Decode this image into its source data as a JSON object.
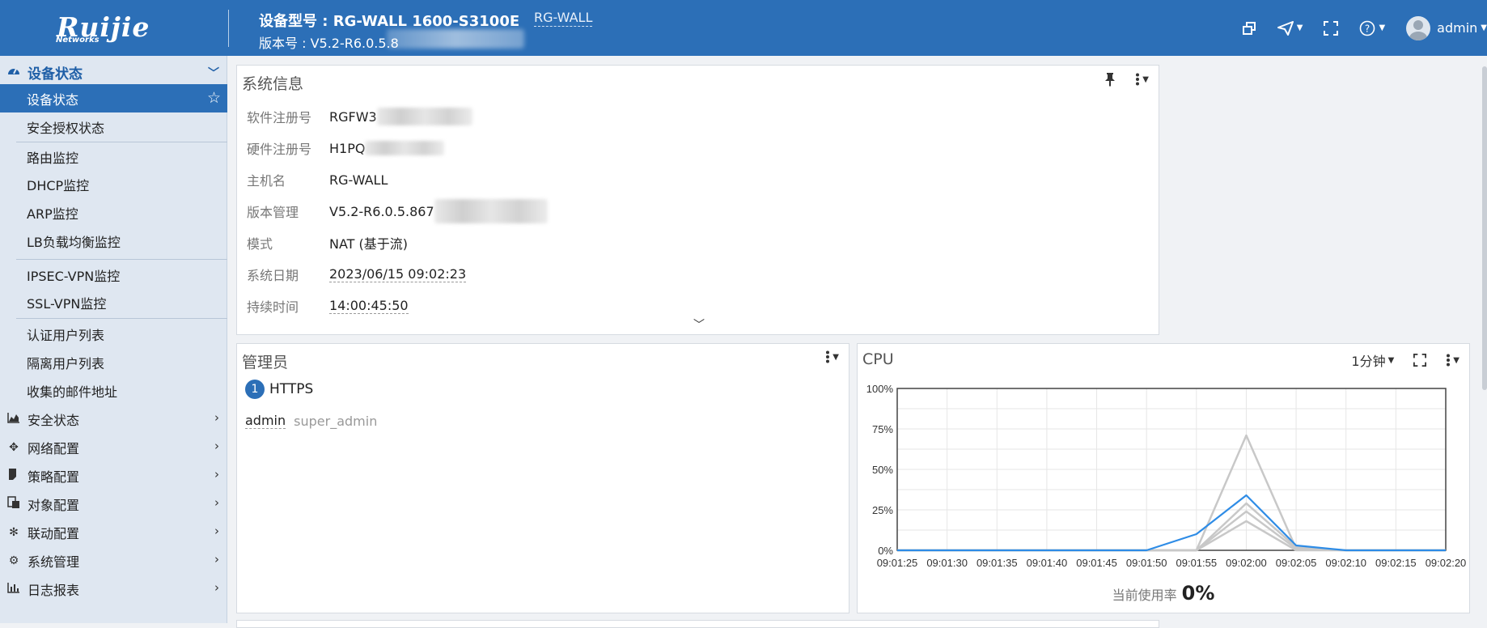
{
  "header": {
    "logo_text": "Ruijie",
    "logo_sub": "Networks",
    "model": "设备型号 : RG-WALL 1600-S3100E",
    "version": "版本号 : V5.2-R6.0.5.8",
    "hostname": "RG-WALL",
    "user": "admin"
  },
  "sidebar": {
    "group_label": "设备状态",
    "sub_items": [
      {
        "label": "设备状态",
        "active": true
      },
      {
        "label": "安全授权状态"
      },
      {
        "label": "路由监控"
      },
      {
        "label": "DHCP监控"
      },
      {
        "label": "ARP监控"
      },
      {
        "label": "LB负载均衡监控"
      },
      {
        "label": "IPSEC-VPN监控"
      },
      {
        "label": "SSL-VPN监控"
      },
      {
        "label": "认证用户列表"
      },
      {
        "label": "隔离用户列表"
      },
      {
        "label": "收集的邮件地址"
      }
    ],
    "categories": [
      {
        "label": "安全状态",
        "icon": "area-chart-icon"
      },
      {
        "label": "网络配置",
        "icon": "move-icon"
      },
      {
        "label": "策略配置",
        "icon": "policy-icon"
      },
      {
        "label": "对象配置",
        "icon": "object-icon"
      },
      {
        "label": "联动配置",
        "icon": "link-icon"
      },
      {
        "label": "系统管理",
        "icon": "gear-icon"
      },
      {
        "label": "日志报表",
        "icon": "bar-chart-icon"
      }
    ]
  },
  "system_info": {
    "title": "系统信息",
    "rows": [
      {
        "label": "软件注册号",
        "value": "RGFW3"
      },
      {
        "label": "硬件注册号",
        "value": "H1PQ"
      },
      {
        "label": "主机名",
        "value": "RG-WALL"
      },
      {
        "label": "版本管理",
        "value": "V5.2-R6.0.5.867"
      },
      {
        "label": "模式",
        "value": "NAT (基于流)"
      },
      {
        "label": "系统日期",
        "value": "2023/06/15 09:02:23"
      },
      {
        "label": "持续时间",
        "value": "14:00:45:50"
      }
    ]
  },
  "admin_panel": {
    "title": "管理员",
    "count": "1",
    "protocol": "HTTPS",
    "user": "admin",
    "role": "super_admin"
  },
  "cpu_panel": {
    "title": "CPU",
    "interval": "1分钟",
    "current_label": "当前使用率",
    "current_value": "0%"
  },
  "chart_data": {
    "type": "line",
    "title": "CPU",
    "x": [
      "09:01:25",
      "09:01:30",
      "09:01:35",
      "09:01:40",
      "09:01:45",
      "09:01:50",
      "09:01:55",
      "09:02:00",
      "09:02:05",
      "09:02:10",
      "09:02:15",
      "09:02:20"
    ],
    "ylim": [
      0,
      100
    ],
    "yticks": [
      "100%",
      "75%",
      "50%",
      "25%",
      "0%"
    ],
    "grid": true,
    "series": [
      {
        "color": "#c8c8c8",
        "values": [
          0,
          0,
          0,
          0,
          0,
          0,
          0,
          71,
          1,
          0,
          0,
          0
        ]
      },
      {
        "color": "#c8c8c8",
        "values": [
          0,
          0,
          0,
          0,
          0,
          0,
          0,
          29,
          2,
          0,
          0,
          0
        ]
      },
      {
        "color": "#c8c8c8",
        "values": [
          0,
          0,
          0,
          0,
          0,
          0,
          0,
          24,
          1,
          0,
          0,
          0
        ]
      },
      {
        "color": "#c8c8c8",
        "values": [
          0,
          0,
          0,
          0,
          0,
          0,
          0,
          18,
          0,
          0,
          0,
          0
        ]
      },
      {
        "color": "#2e8ce6",
        "values": [
          0,
          0,
          0,
          0,
          0,
          0,
          10,
          34,
          3,
          0,
          0,
          0
        ]
      }
    ]
  }
}
